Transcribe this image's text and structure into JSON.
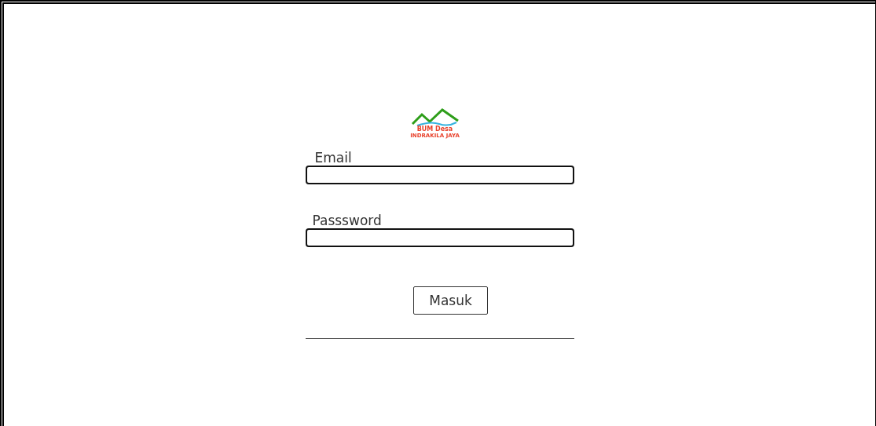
{
  "logo": {
    "title": "BUM Desa",
    "subtitle": "INDRAKILA JAYA"
  },
  "fields": [
    {
      "label": "Email"
    },
    {
      "label": "Passsword"
    }
  ],
  "button": "Masuk"
}
